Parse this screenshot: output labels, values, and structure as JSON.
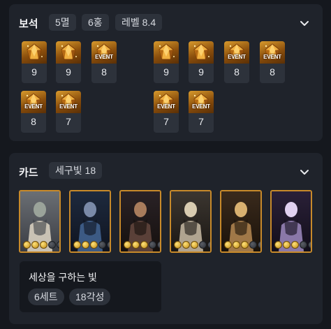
{
  "gems": {
    "title": "보석",
    "chips": [
      "5멸",
      "6홍",
      "레벨 8.4"
    ],
    "items": [
      {
        "level": "9",
        "event": ""
      },
      {
        "level": "9",
        "event": ""
      },
      {
        "level": "8",
        "event": "EVENT"
      },
      {
        "level": "9",
        "event": ""
      },
      {
        "level": "9",
        "event": ""
      },
      {
        "level": "8",
        "event": "EVENT"
      },
      {
        "level": "8",
        "event": "EVENT"
      },
      {
        "level": "8",
        "event": "EVENT"
      },
      {
        "level": "7",
        "event": "EVENT"
      },
      {
        "level": "7",
        "event": "EVENT"
      },
      {
        "level": "7",
        "event": "EVENT"
      }
    ]
  },
  "cards": {
    "title": "카드",
    "chip": "세구빛 18",
    "items": [
      {
        "awakening": 3
      },
      {
        "awakening": 3
      },
      {
        "awakening": 3
      },
      {
        "awakening": 3
      },
      {
        "awakening": 3
      },
      {
        "awakening": 3
      }
    ],
    "set": {
      "name": "세상을 구하는 빛",
      "tags": [
        "6세트",
        "18각성"
      ]
    }
  },
  "colors": {
    "card_border": "#c88a2a",
    "gem_art": "#c8841e",
    "panel_bg": "#1f232b"
  },
  "icons": {
    "collapse": "chevron-down-icon"
  }
}
